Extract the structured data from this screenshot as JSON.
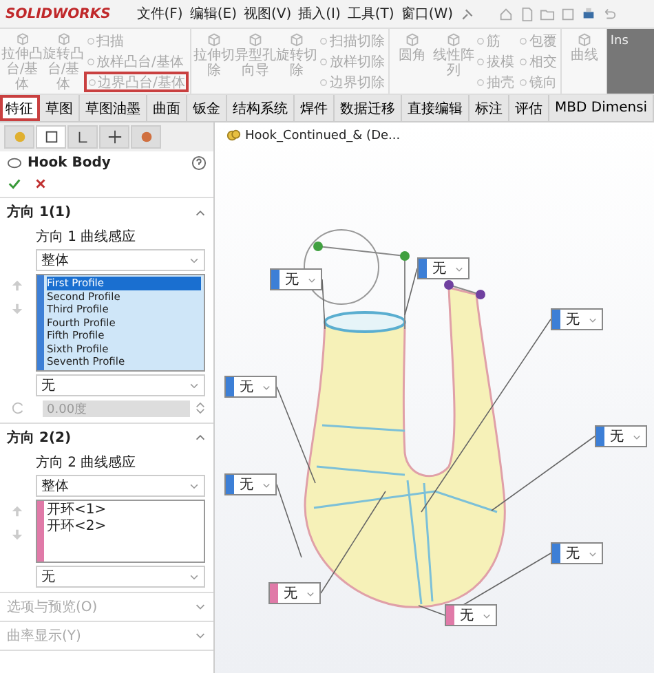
{
  "app": {
    "logo": "SOLIDWORKS"
  },
  "menu": [
    "文件(F)",
    "编辑(E)",
    "视图(V)",
    "插入(I)",
    "工具(T)",
    "窗口(W)"
  ],
  "toolbar": {
    "groups": [
      {
        "large": [
          "拉伸凸台/基体",
          "旋转凸台/基体"
        ],
        "small": [
          {
            "label": "扫描",
            "marked": false
          },
          {
            "label": "放样凸台/基体",
            "marked": false
          },
          {
            "label": "边界凸台/基体",
            "marked": true
          }
        ]
      },
      {
        "large": [
          "拉伸切除",
          "异型孔向导",
          "旋转切除"
        ],
        "small": [
          {
            "label": "扫描切除",
            "marked": false
          },
          {
            "label": "放样切除",
            "marked": false
          },
          {
            "label": "边界切除",
            "marked": false
          }
        ]
      },
      {
        "large": [
          "圆角",
          "线性阵列"
        ],
        "small": [
          {
            "label": "筋",
            "marked": false
          },
          {
            "label": "拔模",
            "marked": false
          },
          {
            "label": "抽壳",
            "marked": false
          },
          {
            "label": "包覆",
            "marked": false
          },
          {
            "label": "相交",
            "marked": false
          },
          {
            "label": "镜向",
            "marked": false
          }
        ]
      },
      {
        "large": [
          "曲线"
        ]
      }
    ],
    "panel": "Ins"
  },
  "tabs": [
    {
      "label": "特征",
      "selected": true
    },
    {
      "label": "草图",
      "selected": false
    },
    {
      "label": "草图油墨",
      "selected": false
    },
    {
      "label": "曲面",
      "selected": false
    },
    {
      "label": "钣金",
      "selected": false
    },
    {
      "label": "结构系统",
      "selected": false
    },
    {
      "label": "焊件",
      "selected": false
    },
    {
      "label": "数据迁移",
      "selected": false
    },
    {
      "label": "直接编辑",
      "selected": false
    },
    {
      "label": "标注",
      "selected": false
    },
    {
      "label": "评估",
      "selected": false
    },
    {
      "label": "MBD Dimensi",
      "selected": false
    }
  ],
  "property_manager": {
    "icon_tabs": [
      {
        "selected": false
      },
      {
        "selected": true
      },
      {
        "selected": false
      },
      {
        "selected": false
      },
      {
        "selected": false
      }
    ],
    "title": "Hook Body",
    "directions": [
      {
        "title": "方向 1(1)",
        "expanded": true,
        "curve_label": "方向 1 曲线感应",
        "scope": "整体",
        "color": "#3d7fd6",
        "items": [
          {
            "label": "First Profile",
            "selected": true
          },
          {
            "label": "Second Profile",
            "selected": false
          },
          {
            "label": "Third Profile",
            "selected": false
          },
          {
            "label": "Fourth Profile",
            "selected": false
          },
          {
            "label": "Fifth Profile",
            "selected": false
          },
          {
            "label": "Sixth Profile",
            "selected": false
          },
          {
            "label": "Seventh Profile",
            "selected": false
          }
        ],
        "end_condition": "无",
        "angle": "0.00度"
      },
      {
        "title": "方向 2(2)",
        "expanded": true,
        "curve_label": "方向 2 曲线感应",
        "scope": "整体",
        "color": "#e07aa8",
        "items": [
          {
            "label": "开环<1>",
            "selected": false
          },
          {
            "label": "开环<2>",
            "selected": false
          }
        ],
        "end_condition": "无"
      }
    ],
    "collapsed": [
      {
        "title": "选项与预览(O)",
        "expanded": false
      },
      {
        "title": "曲率显示(Y)",
        "expanded": false
      }
    ]
  },
  "viewport": {
    "tree_item": "Hook_Continued_& (De...",
    "callouts": [
      {
        "value": "无",
        "color": "#3d7fd6"
      },
      {
        "value": "无",
        "color": "#3d7fd6"
      },
      {
        "value": "无",
        "color": "#3d7fd6"
      },
      {
        "value": "无",
        "color": "#3d7fd6"
      },
      {
        "value": "无",
        "color": "#3d7fd6"
      },
      {
        "value": "无",
        "color": "#3d7fd6"
      },
      {
        "value": "无",
        "color": "#3d7fd6"
      },
      {
        "value": "无",
        "color": "#e07aa8"
      },
      {
        "value": "无",
        "color": "#e07aa8"
      }
    ]
  }
}
